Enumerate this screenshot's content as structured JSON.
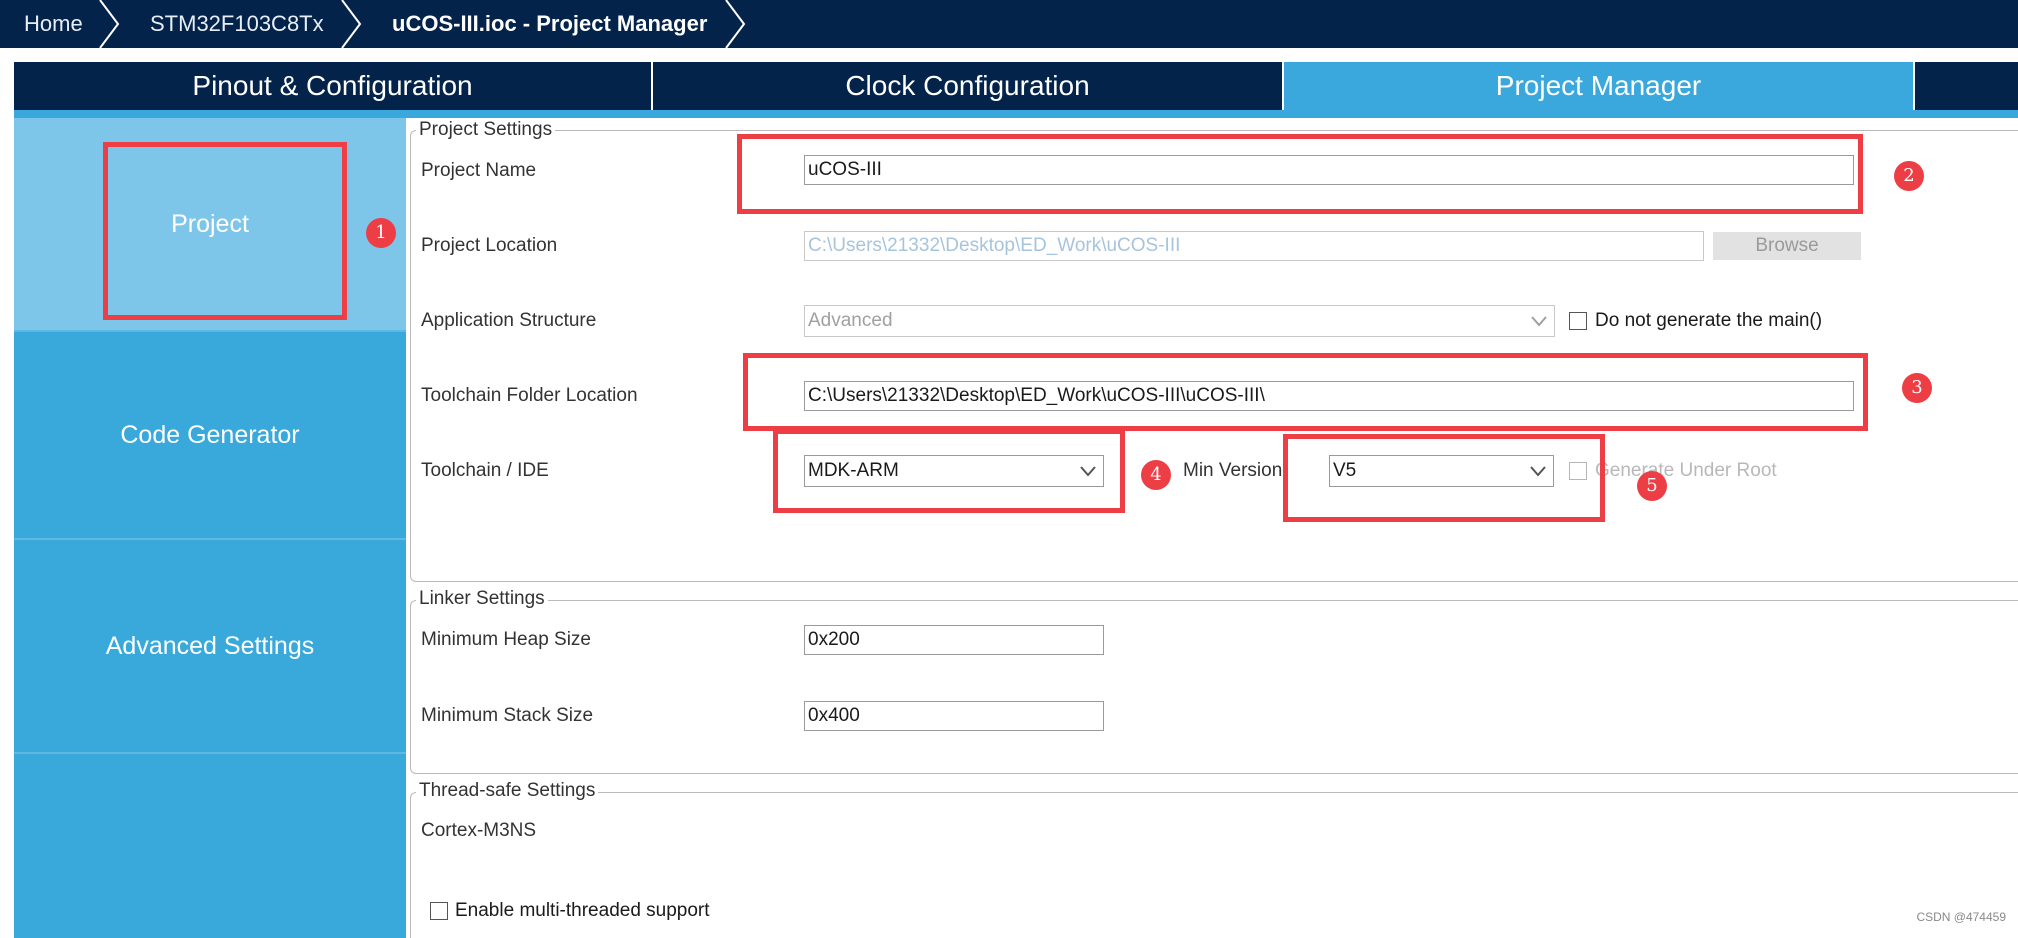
{
  "breadcrumbs": {
    "home": "Home",
    "device": "STM32F103C8Tx",
    "current": "uCOS-III.ioc - Project Manager"
  },
  "tabs": [
    {
      "label": "Pinout & Configuration",
      "active": false
    },
    {
      "label": "Clock Configuration",
      "active": false
    },
    {
      "label": "Project Manager",
      "active": true
    }
  ],
  "sidebar": {
    "items": [
      {
        "label": "Project",
        "active": true
      },
      {
        "label": "Code Generator",
        "active": false
      },
      {
        "label": "Advanced Settings",
        "active": false
      }
    ]
  },
  "project_settings": {
    "title": "Project Settings",
    "project_name_label": "Project Name",
    "project_name_value": "uCOS-III",
    "project_location_label": "Project Location",
    "project_location_value": "C:\\Users\\21332\\Desktop\\ED_Work\\uCOS-III",
    "browse_label": "Browse",
    "app_structure_label": "Application Structure",
    "app_structure_value": "Advanced",
    "do_not_generate_main_label": "Do not generate the main()",
    "toolchain_folder_label": "Toolchain Folder Location",
    "toolchain_folder_value": "C:\\Users\\21332\\Desktop\\ED_Work\\uCOS-III\\uCOS-III\\",
    "toolchain_ide_label": "Toolchain / IDE",
    "toolchain_ide_value": "MDK-ARM",
    "min_version_label": "Min Version",
    "min_version_value": "V5",
    "generate_under_root_label": "Generate Under Root"
  },
  "linker_settings": {
    "title": "Linker Settings",
    "heap_label": "Minimum Heap Size",
    "heap_value": "0x200",
    "stack_label": "Minimum Stack Size",
    "stack_value": "0x400"
  },
  "thread_safe_settings": {
    "title": "Thread-safe Settings",
    "core_label": "Cortex-M3NS",
    "multithread_label": "Enable multi-threaded support"
  },
  "annotations": [
    "1",
    "2",
    "3",
    "4",
    "5"
  ],
  "watermark": "CSDN @474459",
  "colors": {
    "header_navy": "#03234b",
    "accent_blue": "#3aa8dc",
    "sidebar_active": "#7dc6ea",
    "highlight_red": "#ee3e45"
  }
}
